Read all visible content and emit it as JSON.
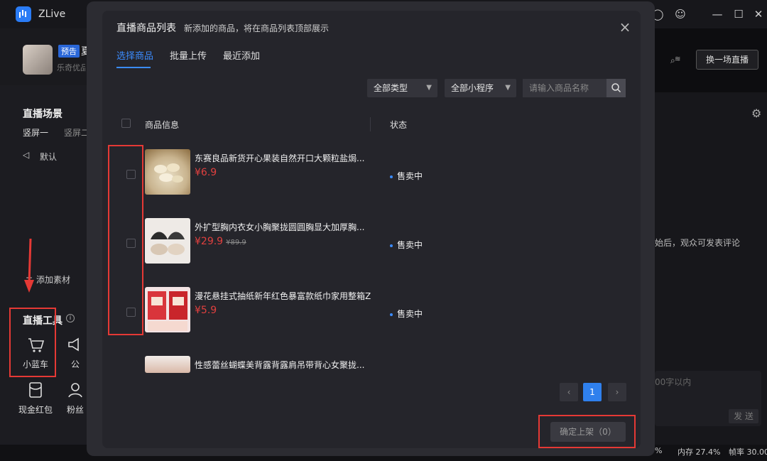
{
  "app": {
    "title": "ZLive"
  },
  "host": {
    "badge": "预告",
    "name_partial": "夏",
    "sub": "乐奇优品"
  },
  "top_right": {
    "switch_button": "换一场直播"
  },
  "left": {
    "scene_title": "直播场景",
    "scene_tabs": [
      "竖屏一",
      "竖屏二"
    ],
    "default_label": "默认",
    "add_material": "添加素材",
    "tools_title": "直播工具",
    "tools": [
      "小蓝车",
      "公",
      "现金红包",
      "粉丝"
    ]
  },
  "right": {
    "comment_hint": "始后，观众可发表评论",
    "input_hint": "00字以内",
    "send": "发 送",
    "status": {
      "memory": "内存 27.4%",
      "fps": "帧率 30.00",
      "prefix": "%"
    }
  },
  "dialog": {
    "title": "直播商品列表",
    "subtitle": "新添加的商品，将在商品列表顶部展示",
    "tabs": [
      "选择商品",
      "批量上传",
      "最近添加"
    ],
    "filters": {
      "type": "全部类型",
      "program": "全部小程序",
      "search_placeholder": "请输入商品名称"
    },
    "columns": {
      "info": "商品信息",
      "status": "状态"
    },
    "products": [
      {
        "name": "东赛良品新货开心果装自然开口大颗粒盐焗...",
        "price": "¥6.9",
        "orig": "",
        "status": "售卖中"
      },
      {
        "name": "外扩型胸内衣女小胸聚拢圆圆胸显大加厚胸...",
        "price": "¥29.9",
        "orig": "¥89.9",
        "status": "售卖中"
      },
      {
        "name": "漫花悬挂式抽纸新年红色暴富款纸巾家用整箱Z",
        "price": "¥5.9",
        "orig": "",
        "status": "售卖中"
      },
      {
        "name": "性感蕾丝蝴蝶美背露背露肩吊带背心女聚拢...",
        "price": "",
        "orig": "",
        "status": ""
      }
    ],
    "pagination": {
      "current": "1",
      "prev": "‹",
      "next": "›"
    },
    "confirm": "确定上架（0）",
    "close": "×"
  },
  "colors": {
    "accent": "#3b8cff",
    "price": "#e0403f",
    "annotation": "#e53935"
  }
}
